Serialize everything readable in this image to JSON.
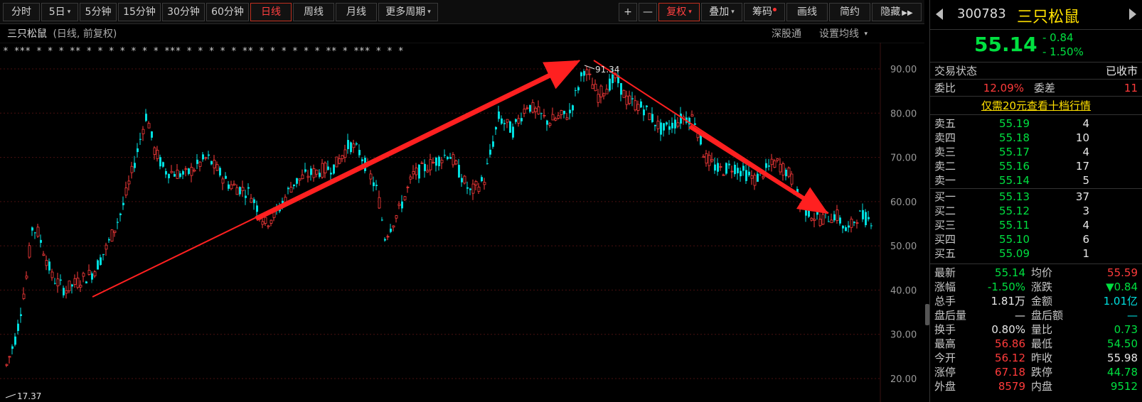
{
  "toolbar": {
    "buttons": [
      {
        "label": "分时"
      },
      {
        "label": "5日",
        "caret": "▾"
      },
      {
        "label": "5分钟"
      },
      {
        "label": "15分钟"
      },
      {
        "label": "30分钟"
      },
      {
        "label": "60分钟"
      },
      {
        "label": "日线",
        "active": true
      },
      {
        "label": "周线"
      },
      {
        "label": "月线"
      },
      {
        "label": "更多周期",
        "caret": "▾"
      }
    ],
    "right_buttons": [
      {
        "label": "+"
      },
      {
        "label": "—"
      },
      {
        "label": "复权",
        "caret": "▾",
        "active": true
      },
      {
        "label": "叠加",
        "caret": "▾"
      },
      {
        "label": "筹码"
      },
      {
        "label": "画线"
      },
      {
        "label": "简约"
      },
      {
        "label": "隐藏",
        "suffix": "▶▶"
      }
    ]
  },
  "chart_header": {
    "stock_name": "三只松鼠",
    "period_info": "(日线, 前复权)",
    "shen_link": "深股通",
    "ma_settings": "设置均线",
    "ma_caret": "▾"
  },
  "chart_data": {
    "type": "candlestick",
    "y_ticks": [
      "90.00",
      "80.00",
      "70.00",
      "60.00",
      "50.00",
      "40.00",
      "30.00",
      "20.00"
    ],
    "ylim": [
      17.37,
      91.34
    ],
    "max_label": "91.34",
    "min_label": "17.37",
    "colors": {
      "up": "#ff3b3b",
      "down": "#00e0e0",
      "annotation": "#ff2020",
      "grid": "#4a1010",
      "axis_text": "#9a9a9a"
    },
    "event_markers": "*  ***  *  *  *   **  *   *   *   * *  *  *  ***   *   *   *  * *   ** *  * *   *   *  * **   *  ***  *   *  *"
  },
  "right_panel": {
    "code": "300783",
    "name": "三只松鼠",
    "price": "55.14",
    "change": "- 0.84",
    "change_pct": "- 1.50%",
    "status_label": "交易状态",
    "status_value": "已收市",
    "wb_label": "委比",
    "wb_value": "12.09%",
    "wc_label": "委差",
    "wc_value": "11",
    "ten_level": "仅需20元查看十档行情",
    "sell": [
      {
        "label": "卖五",
        "price": "55.19",
        "vol": "4"
      },
      {
        "label": "卖四",
        "price": "55.18",
        "vol": "10"
      },
      {
        "label": "卖三",
        "price": "55.17",
        "vol": "4"
      },
      {
        "label": "卖二",
        "price": "55.16",
        "vol": "17"
      },
      {
        "label": "卖一",
        "price": "55.14",
        "vol": "5"
      }
    ],
    "buy": [
      {
        "label": "买一",
        "price": "55.13",
        "vol": "37"
      },
      {
        "label": "买二",
        "price": "55.12",
        "vol": "3"
      },
      {
        "label": "买三",
        "price": "55.11",
        "vol": "4"
      },
      {
        "label": "买四",
        "price": "55.10",
        "vol": "6"
      },
      {
        "label": "买五",
        "price": "55.09",
        "vol": "1"
      }
    ],
    "stats": [
      {
        "l1": "最新",
        "v1": "55.14",
        "c1": "green",
        "l2": "均价",
        "v2": "55.59",
        "c2": "red"
      },
      {
        "l1": "涨幅",
        "v1": "-1.50%",
        "c1": "green",
        "l2": "涨跌",
        "v2": "▼0.84",
        "c2": "green"
      },
      {
        "l1": "总手",
        "v1": "1.81万",
        "c1": "white",
        "l2": "金额",
        "v2": "1.01亿",
        "c2": "cyan"
      },
      {
        "l1": "盘后量",
        "v1": "—",
        "c1": "white",
        "l2": "盘后额",
        "v2": "—",
        "c2": "cyan"
      },
      {
        "l1": "换手",
        "v1": "0.80%",
        "c1": "white",
        "l2": "量比",
        "v2": "0.73",
        "c2": "green"
      },
      {
        "l1": "最高",
        "v1": "56.86",
        "c1": "red",
        "l2": "最低",
        "v2": "54.50",
        "c2": "green"
      },
      {
        "l1": "今开",
        "v1": "56.12",
        "c1": "red",
        "l2": "昨收",
        "v2": "55.98",
        "c2": "white"
      },
      {
        "l1": "涨停",
        "v1": "67.18",
        "c1": "red",
        "l2": "跌停",
        "v2": "44.78",
        "c2": "green"
      },
      {
        "l1": "外盘",
        "v1": "8579",
        "c1": "red",
        "l2": "内盘",
        "v2": "9512",
        "c2": "green"
      }
    ]
  }
}
